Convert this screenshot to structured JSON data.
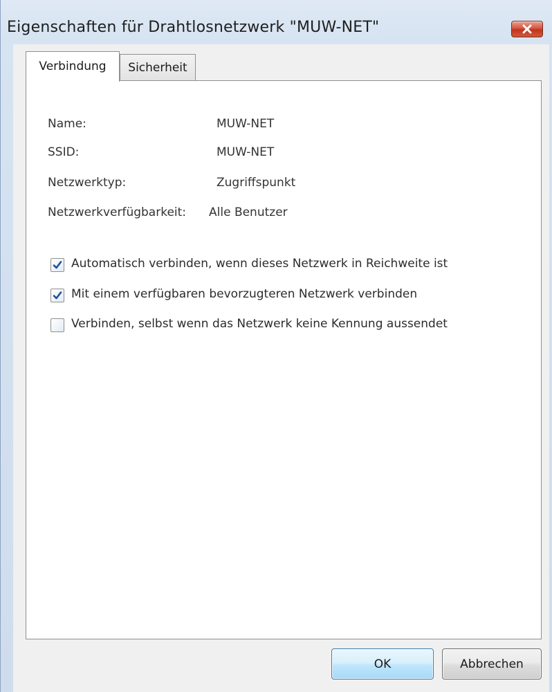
{
  "window": {
    "title": "Eigenschaften für Drahtlosnetzwerk \"MUW-NET\"",
    "close_icon": "close-icon"
  },
  "tabs": [
    {
      "label": "Verbindung",
      "active": true
    },
    {
      "label": "Sicherheit",
      "active": false
    }
  ],
  "properties": [
    {
      "label": "Name:",
      "value": "MUW-NET"
    },
    {
      "label": "SSID:",
      "value": "MUW-NET"
    },
    {
      "label": "Netzwerktyp:",
      "value": "Zugriffspunkt"
    },
    {
      "label": "Netzwerkverfügbarkeit:",
      "value": "Alle Benutzer"
    }
  ],
  "options": [
    {
      "label": "Automatisch verbinden, wenn dieses Netzwerk in Reichweite ist",
      "checked": true
    },
    {
      "label": "Mit einem verfügbaren bevorzugteren Netzwerk verbinden",
      "checked": true
    },
    {
      "label": "Verbinden, selbst wenn das Netzwerk keine Kennung aussendet",
      "checked": false
    }
  ],
  "buttons": {
    "ok": "OK",
    "cancel": "Abbrechen"
  },
  "colors": {
    "checkmark": "#1e4f9c",
    "close_button": "#c0341d",
    "ok_button_border": "#3c7fb1"
  }
}
